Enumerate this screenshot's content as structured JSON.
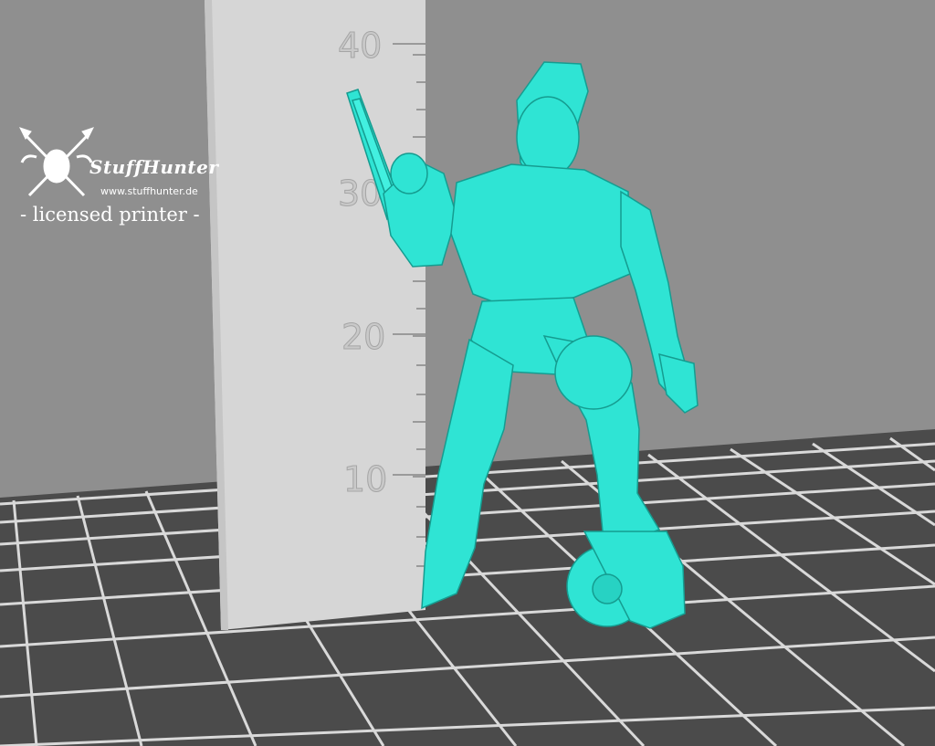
{
  "watermark": {
    "brand_name": "StuffHunter",
    "website": "www.stuffhunter.de",
    "tagline": "- licensed printer -"
  },
  "scale_ruler": {
    "unit_labels": [
      "40",
      "30",
      "20",
      "10"
    ]
  },
  "model": {
    "color": "#2ee6d6"
  },
  "scene": {
    "wall_color": "#8e8e8e",
    "floor_color": "#4a4a4a",
    "grid_color": "#dcdcdc",
    "ruler_color": "#d8d8d8"
  }
}
